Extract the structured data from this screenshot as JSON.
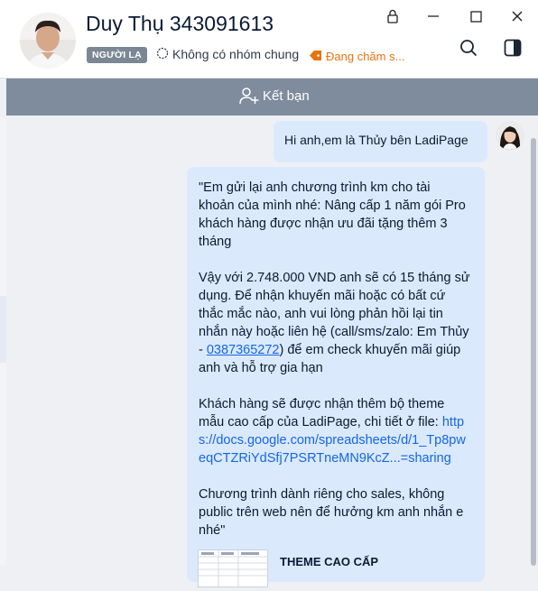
{
  "header": {
    "contact_name": "Duy Thụ 343091613",
    "badge": "NGƯỜI LẠ",
    "mutual_groups": "Không có nhóm chung",
    "tag_label": "Đang chăm s..."
  },
  "window_controls": {
    "lock_icon": "lock-icon",
    "minimize_icon": "minimize-icon",
    "maximize_icon": "maximize-icon",
    "close_icon": "close-icon"
  },
  "actions": {
    "search_icon": "search-icon",
    "panel_icon": "panel-toggle-icon"
  },
  "friend_bar": {
    "label": "Kết bạn",
    "icon": "add-friend-icon"
  },
  "messages": [
    {
      "text": "Hi anh,em là Thủy bên LadiPage"
    },
    {
      "lines": [
        "\"Em gửi lại anh chương trình km cho tài",
        "khoản của mình nhé: Nâng cấp 1 năm gói Pro",
        "khách hàng được nhận ưu đãi tặng thêm 3",
        "tháng",
        "Vậy với 2.748.000 VND anh sẽ có 15 tháng sử",
        "dụng. Để nhận khuyến mãi hoặc có bất cứ",
        "thắc mắc nào, anh vui lòng phản hồi lại tin",
        "nhắn này hoặc liên hệ (call/sms/zalo: Em Thủy",
        "- ",
        "0387365272",
        ") để em check khuyến mãi giúp",
        "anh và hỗ trợ gia hạn",
        "Khách hàng sẽ được nhận thêm bộ theme",
        "mẫu cao cấp của LadiPage, chi tiết ở file: ",
        "http",
        "s://docs.google.com/spreadsheets/d/1_Tp8pw",
        "eqCTZRiYdSfj7PSRTneMN9KcZ...=sharing",
        "Chương trình dành riêng cho sales, không",
        "public trên web nên để hưởng km anh nhắn e",
        "nhé\""
      ],
      "attachment_title": "THEME CAO CẤP"
    }
  ],
  "colors": {
    "bubble": "#dbe9fd",
    "link": "#1467e6",
    "tag": "#e8730f",
    "friend_bar": "#7f8c9d"
  }
}
